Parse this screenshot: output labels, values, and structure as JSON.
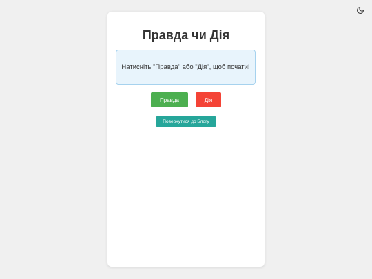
{
  "header": {
    "theme_toggle_icon": "moon-icon"
  },
  "game": {
    "title": "Правда чи Дія",
    "prompt": "Натисніть \"Правда\" або \"Дія\", щоб почати!",
    "truth_label": "Правда",
    "dare_label": "Дія",
    "back_label": "Повернутися до Блогу"
  },
  "colors": {
    "background": "#f0f0f0",
    "card": "#ffffff",
    "prompt_bg": "#e8f4fc",
    "prompt_border": "#a6d2ee",
    "truth": "#4caf50",
    "dare": "#f44336",
    "back": "#26a69a"
  }
}
